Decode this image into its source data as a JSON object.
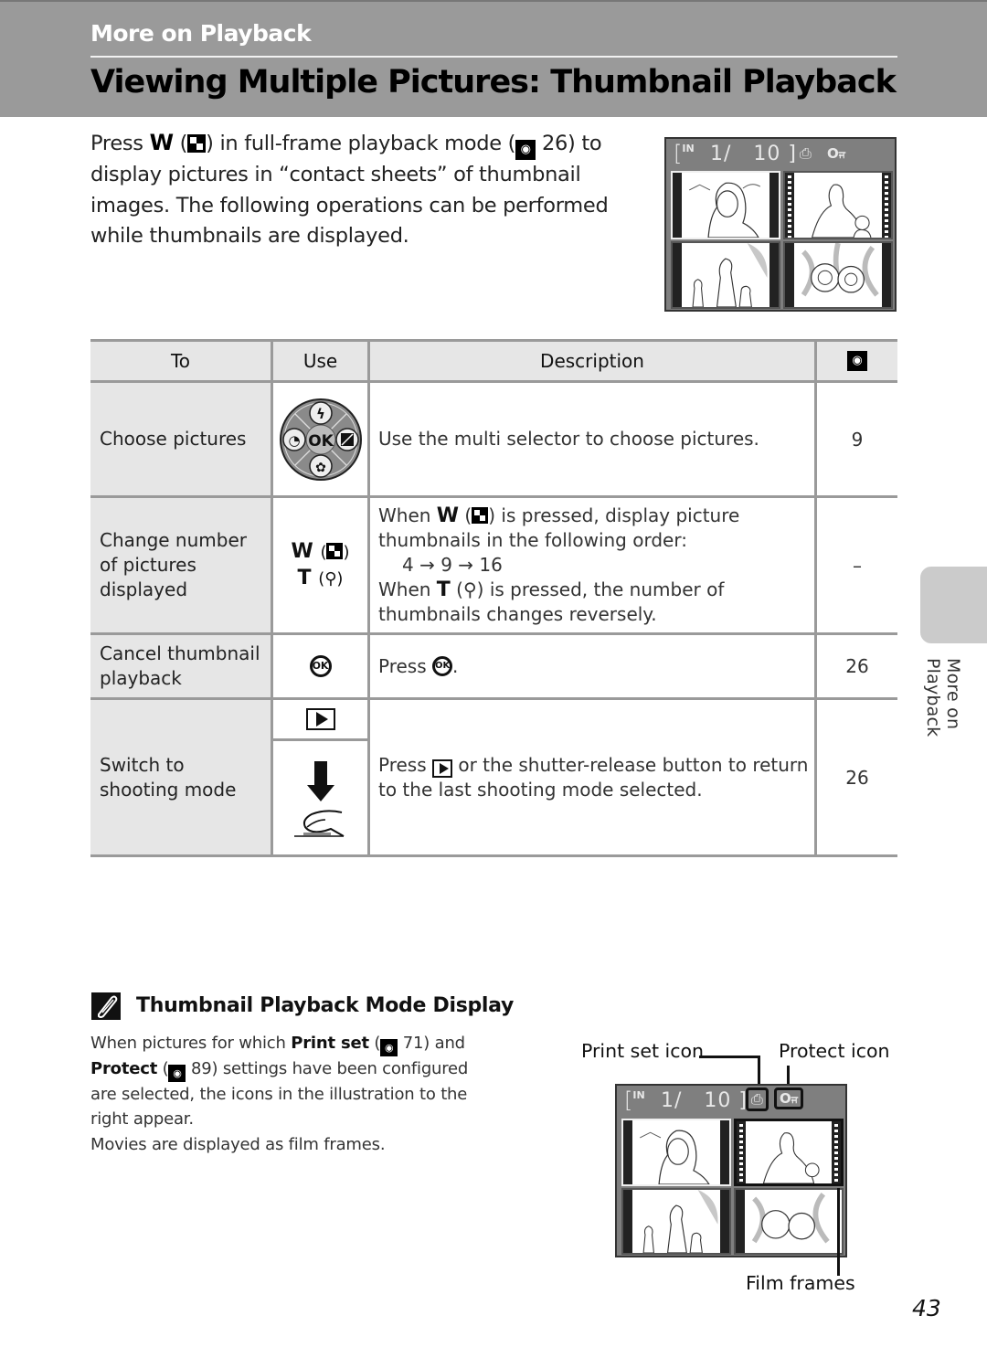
{
  "header": {
    "section": "More on Playback",
    "title": "Viewing Multiple Pictures: Thumbnail Playback"
  },
  "intro": {
    "press": "Press",
    "w_key": "W",
    "grid_icon": "thumbnail-grid-icon",
    "text_1": "in full-frame playback mode (",
    "ref_page": "26",
    "text_2": ") to display pictures in “contact sheets” of thumbnail images. The following operations can be performed while thumbnails are displayed."
  },
  "camera_display": {
    "memory_label": "IN",
    "frame_counter": "1/   10",
    "icons": [
      "print-set-icon",
      "protect-icon"
    ],
    "thumbnails": [
      {
        "subject": "woman portrait",
        "selected": true,
        "movie": false
      },
      {
        "subject": "woman with child",
        "selected": false,
        "movie": true
      },
      {
        "subject": "family walking",
        "selected": false,
        "movie": false
      },
      {
        "subject": "flowers",
        "selected": false,
        "movie": false
      }
    ]
  },
  "table": {
    "headers": {
      "to": "To",
      "use": "Use",
      "description": "Description",
      "ref": "reference-icon"
    },
    "rows": [
      {
        "to": "Choose pictures",
        "use": "multi-selector-icon",
        "description": "Use the multi selector to choose pictures.",
        "ref": "9"
      },
      {
        "to_lines": [
          "Change number",
          "of pictures",
          "displayed"
        ],
        "use_w": "W",
        "use_t": "T",
        "description_1a": "When",
        "description_1b": "is pressed, display picture thumbnails in the following order:",
        "order": "4 → 9 → 16",
        "description_2a": "When",
        "description_2b": "is pressed, the number of thumbnails changes reversely.",
        "ref": "–"
      },
      {
        "to_lines": [
          "Cancel thumbnail",
          "playback"
        ],
        "use": "ok-button-icon",
        "description_a": "Press",
        "description_b": ".",
        "ref": "26"
      },
      {
        "to_lines": [
          "Switch to",
          "shooting mode"
        ],
        "use_top": "playback-button-icon",
        "use_bottom": "shutter-release-icon",
        "description_a": "Press",
        "description_b": "or the shutter-release button to return to the last shooting mode selected.",
        "ref": "26"
      }
    ]
  },
  "side_tab": {
    "label": "More on Playback"
  },
  "note": {
    "title": "Thumbnail Playback Mode Display",
    "p1_a": "When pictures for which",
    "p1_print_set": "Print set",
    "p1_ref1": "71",
    "p1_b": ") and",
    "p1_protect": "Protect",
    "p1_ref2": "89",
    "p1_c": ") settings have been configured are selected, the icons in the illustration to the right appear.",
    "p2": "Movies are displayed as film frames."
  },
  "callouts": {
    "print_set": "Print set icon",
    "protect": "Protect icon",
    "film": "Film frames"
  },
  "page_number": "43"
}
